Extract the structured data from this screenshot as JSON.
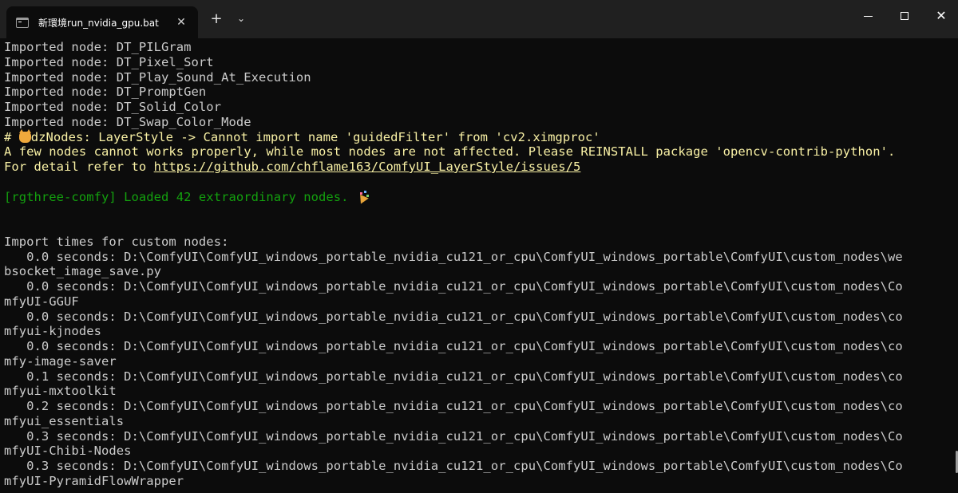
{
  "window": {
    "tab_title": "新環境run_nvidia_gpu.bat",
    "tab_close_glyph": "✕",
    "new_tab_glyph": "+",
    "dropdown_glyph": "⌄",
    "close_glyph": "✕",
    "icons": {
      "tab": "terminal-icon",
      "minimize": "minimize-icon",
      "maximize": "maximize-icon",
      "close": "close-icon"
    }
  },
  "colors": {
    "background": "#0c0c0c",
    "titlebar": "#202020",
    "text": "#cccccc",
    "warning": "#f9f1a5",
    "success": "#13a10e"
  },
  "terminal": {
    "lines": [
      "Imported node: DT_PILGram",
      "Imported node: DT_Pixel_Sort",
      "Imported node: DT_Play_Sound_At_Execution",
      "Imported node: DT_PromptGen",
      "Imported node: DT_Solid_Color",
      "Imported node: DT_Swap_Color_Mode"
    ],
    "warning_prefix": "# ",
    "warning_rest": "dzNodes: LayerStyle -> Cannot import name 'guidedFilter' from 'cv2.ximgproc'",
    "warning_line2": "A few nodes cannot works properly, while most nodes are not affected. Please REINSTALL package 'opencv-contrib-python'.",
    "detail_prefix": "For detail refer to ",
    "detail_link": "https://github.com/chflame163/ComfyUI_LayerStyle/issues/5",
    "rgthree_line": "[rgthree-comfy] Loaded 42 extraordinary nodes. ",
    "import_header": "Import times for custom nodes:",
    "import_lines": [
      "   0.0 seconds: D:\\ComfyUI\\ComfyUI_windows_portable_nvidia_cu121_or_cpu\\ComfyUI_windows_portable\\ComfyUI\\custom_nodes\\we",
      "bsocket_image_save.py",
      "   0.0 seconds: D:\\ComfyUI\\ComfyUI_windows_portable_nvidia_cu121_or_cpu\\ComfyUI_windows_portable\\ComfyUI\\custom_nodes\\Co",
      "mfyUI-GGUF",
      "   0.0 seconds: D:\\ComfyUI\\ComfyUI_windows_portable_nvidia_cu121_or_cpu\\ComfyUI_windows_portable\\ComfyUI\\custom_nodes\\co",
      "mfyui-kjnodes",
      "   0.0 seconds: D:\\ComfyUI\\ComfyUI_windows_portable_nvidia_cu121_or_cpu\\ComfyUI_windows_portable\\ComfyUI\\custom_nodes\\co",
      "mfy-image-saver",
      "   0.1 seconds: D:\\ComfyUI\\ComfyUI_windows_portable_nvidia_cu121_or_cpu\\ComfyUI_windows_portable\\ComfyUI\\custom_nodes\\co",
      "mfyui-mxtoolkit",
      "   0.2 seconds: D:\\ComfyUI\\ComfyUI_windows_portable_nvidia_cu121_or_cpu\\ComfyUI_windows_portable\\ComfyUI\\custom_nodes\\co",
      "mfyui_essentials",
      "   0.3 seconds: D:\\ComfyUI\\ComfyUI_windows_portable_nvidia_cu121_or_cpu\\ComfyUI_windows_portable\\ComfyUI\\custom_nodes\\Co",
      "mfyUI-Chibi-Nodes",
      "   0.3 seconds: D:\\ComfyUI\\ComfyUI_windows_portable_nvidia_cu121_or_cpu\\ComfyUI_windows_portable\\ComfyUI\\custom_nodes\\Co",
      "mfyUI-PyramidFlowWrapper"
    ]
  }
}
